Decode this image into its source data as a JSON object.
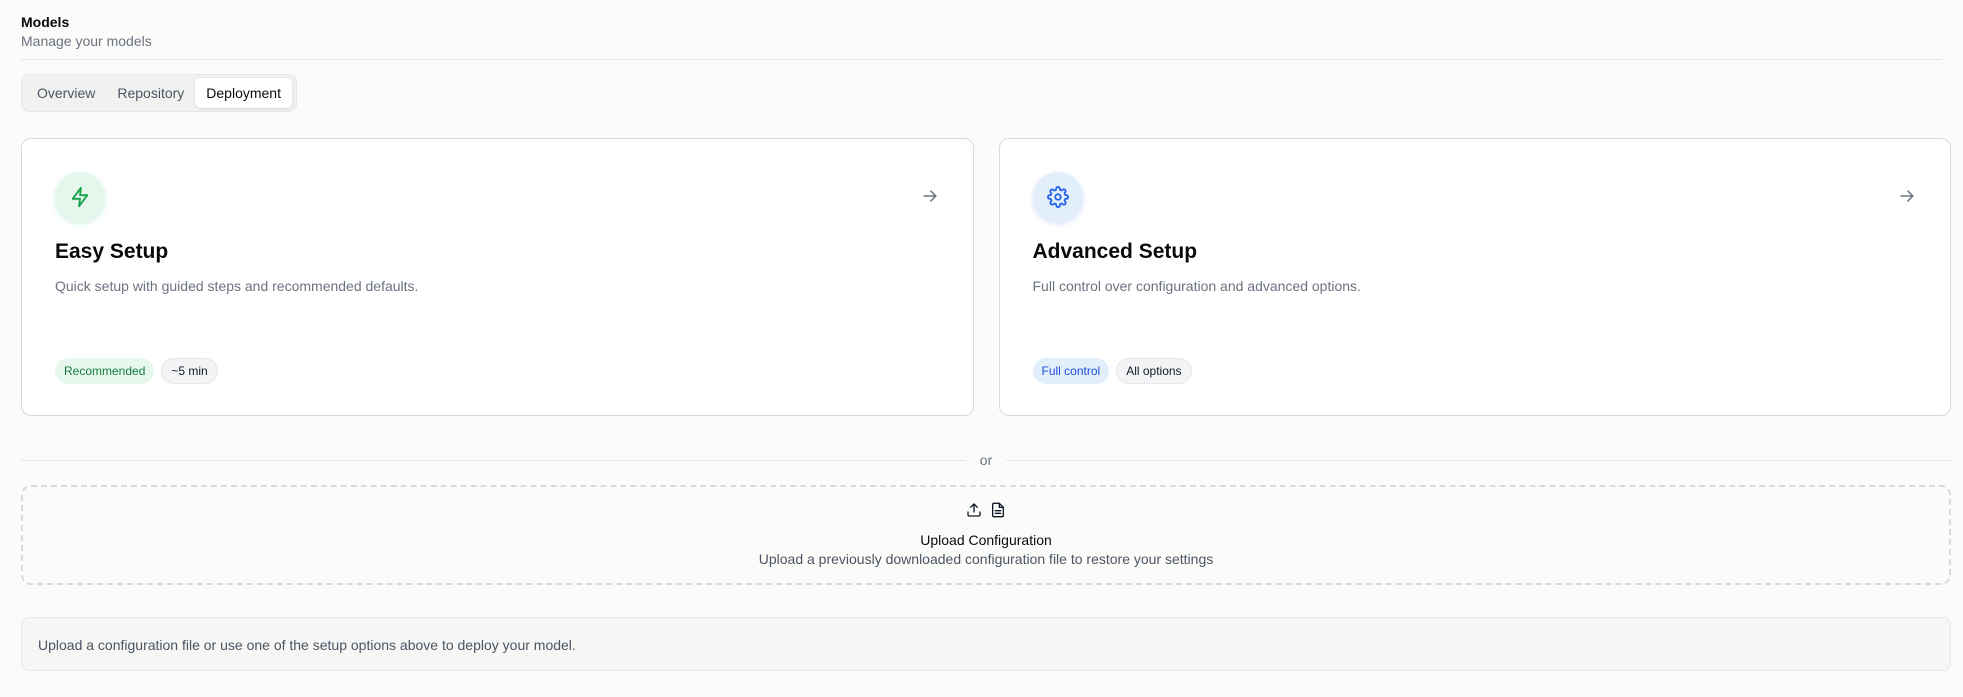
{
  "header": {
    "title": "Models",
    "subtitle": "Manage your models"
  },
  "tabs": [
    {
      "label": "Overview",
      "active": false
    },
    {
      "label": "Repository",
      "active": false
    },
    {
      "label": "Deployment",
      "active": true
    }
  ],
  "cards": [
    {
      "icon": "lightning-icon",
      "title": "Easy Setup",
      "description": "Quick setup with guided steps and recommended defaults.",
      "badges": [
        "Recommended",
        "~5 min"
      ],
      "accent": "#16a34a"
    },
    {
      "icon": "gear-icon",
      "title": "Advanced Setup",
      "description": "Full control over configuration and advanced options.",
      "badges": [
        "Full control",
        "All options"
      ],
      "accent": "#2563eb"
    }
  ],
  "divider": {
    "label": "or"
  },
  "upload": {
    "icons": [
      "upload-icon",
      "file-icon"
    ],
    "title": "Upload Configuration",
    "description": "Upload a previously downloaded configuration file to restore your settings"
  },
  "info": {
    "text": "Upload a configuration file or use one of the setup options above to deploy your model."
  }
}
